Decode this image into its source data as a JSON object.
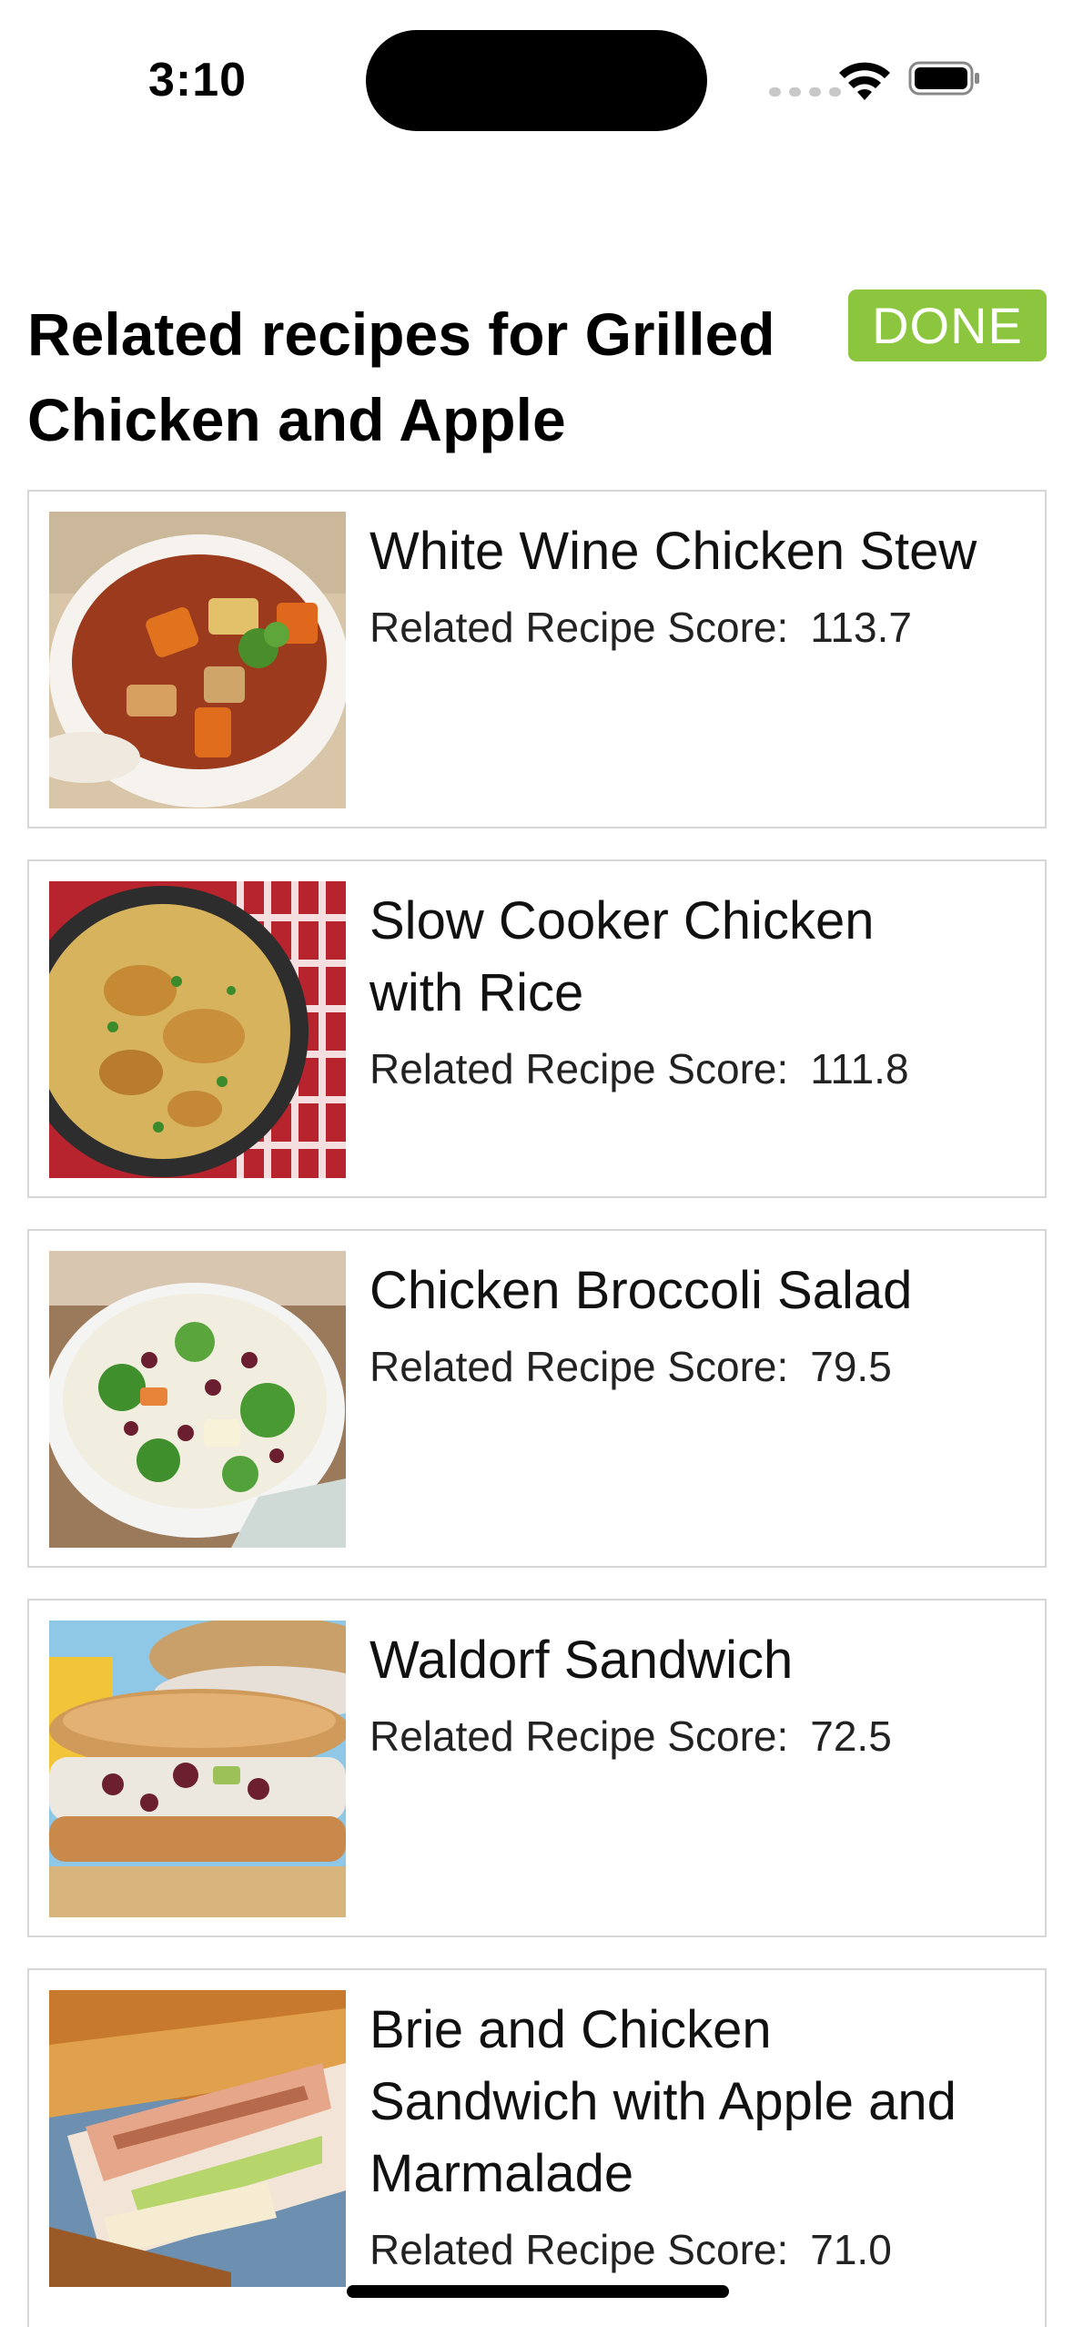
{
  "status_bar": {
    "time": "3:10",
    "icons": [
      "cellular-signal-icon",
      "wifi-icon",
      "battery-icon"
    ]
  },
  "header": {
    "title": "Related recipes for Grilled Chicken and Apple",
    "done_label": "DONE",
    "done_color": "#8cc63f"
  },
  "recipes": [
    {
      "name": "White Wine Chicken Stew",
      "score_label": "Related Recipe Score:",
      "score": "113.7",
      "image": "chicken-stew-image"
    },
    {
      "name": "Slow Cooker Chicken with Rice",
      "score_label": "Related Recipe Score:",
      "score": "111.8",
      "image": "chicken-rice-image"
    },
    {
      "name": "Chicken Broccoli Salad",
      "score_label": "Related Recipe Score:",
      "score": "79.5",
      "image": "broccoli-salad-image"
    },
    {
      "name": "Waldorf Sandwich",
      "score_label": "Related Recipe Score:",
      "score": "72.5",
      "image": "waldorf-sandwich-image"
    },
    {
      "name": "Brie and Chicken Sandwich with Apple and Marmalade",
      "score_label": "Related Recipe Score:",
      "score": "71.0",
      "image": "brie-sandwich-image"
    }
  ]
}
